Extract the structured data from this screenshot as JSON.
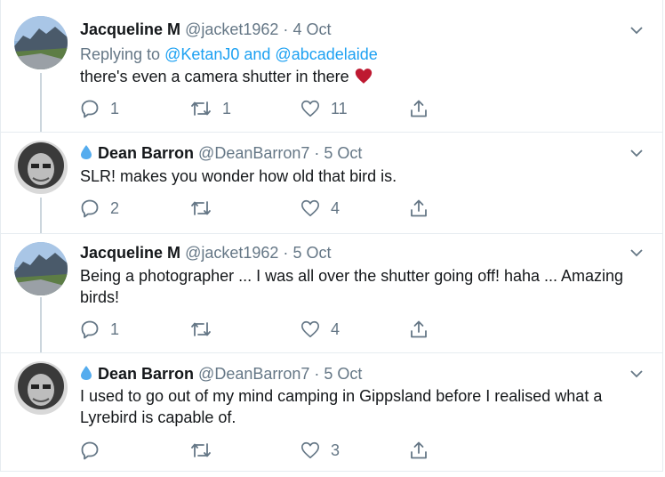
{
  "colors": {
    "accent": "#1da1f2",
    "muted": "#657786",
    "text": "#14171a",
    "line": "#ccd6dd",
    "heart": "#e0245e"
  },
  "tweets": [
    {
      "name": "Jacqueline M",
      "handle": "@jacket1962",
      "date": "4 Oct",
      "dot": "·",
      "replying_label": "Replying to",
      "replying_to": "@KetanJ0 and @abcadelaide",
      "text": "there's even a camera shutter in there",
      "emoji": "red-heart-icon",
      "reply_count": "1",
      "retweet_count": "1",
      "like_count": "11"
    },
    {
      "name": "Dean Barron",
      "handle": "@DeanBarron7",
      "date": "5 Oct",
      "dot": "·",
      "badge_icon": "water-drop-icon",
      "text": "SLR! makes you wonder how old that bird is.",
      "reply_count": "2",
      "retweet_count": "",
      "like_count": "4"
    },
    {
      "name": "Jacqueline M",
      "handle": "@jacket1962",
      "date": "5 Oct",
      "dot": "·",
      "text": "Being a photographer ... I was all over the shutter going off! haha ... Amazing birds!",
      "reply_count": "1",
      "retweet_count": "",
      "like_count": "4"
    },
    {
      "name": "Dean Barron",
      "handle": "@DeanBarron7",
      "date": "5 Oct",
      "dot": "·",
      "badge_icon": "water-drop-icon",
      "text": "I used to go out of my mind camping in Gippsland before I realised what a Lyrebird is capable of.",
      "reply_count": "",
      "retweet_count": "",
      "like_count": "3"
    }
  ]
}
